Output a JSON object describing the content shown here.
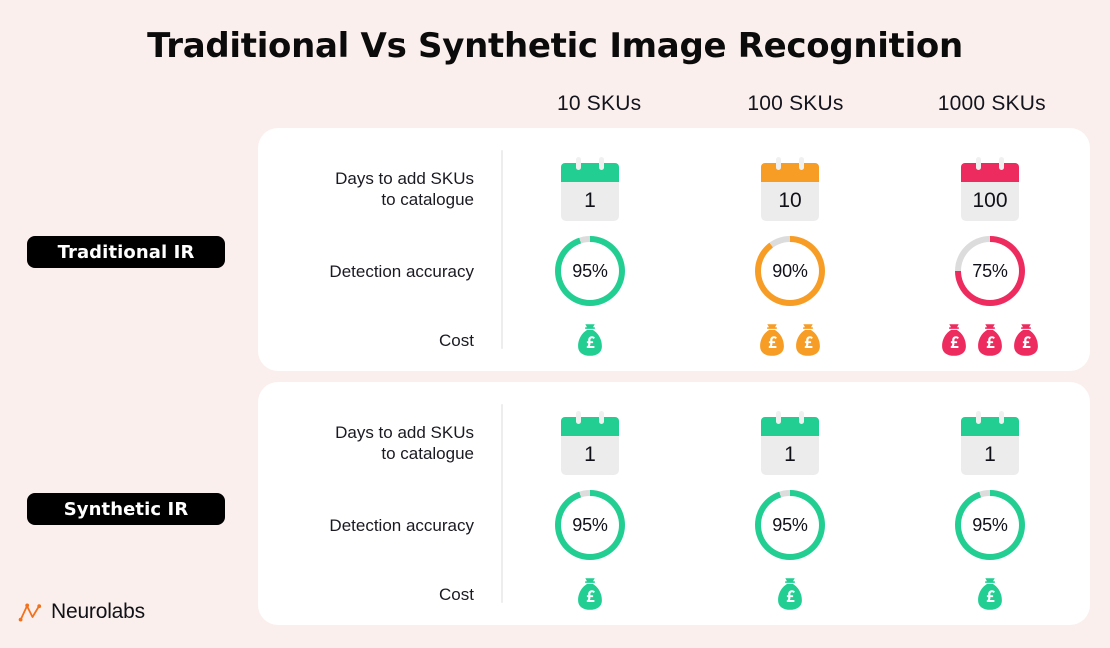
{
  "page": {
    "title": "Traditional Vs Synthetic Image Recognition",
    "background_color": "#FAEFEC",
    "card_color": "#FFFFFF"
  },
  "palette": {
    "green": "#22CE92",
    "orange": "#F79C24",
    "crimson": "#EE2B5E",
    "track_gray": "#DCDCDC",
    "calendar_body": "#ECECEC"
  },
  "columns": [
    {
      "label": "10 SKUs"
    },
    {
      "label": "100 SKUs"
    },
    {
      "label": "1000 SKUs"
    }
  ],
  "row_labels": {
    "days": "Days to add SKUs\nto catalogue",
    "days_line1": "Days to add SKUs",
    "days_line2": "to catalogue",
    "accuracy": "Detection accuracy",
    "cost": "Cost"
  },
  "sections": [
    {
      "badge": "Traditional IR",
      "days": [
        {
          "value": "1",
          "color": "#22CE92"
        },
        {
          "value": "10",
          "color": "#F79C24"
        },
        {
          "value": "100",
          "color": "#EE2B5E"
        }
      ],
      "accuracy": [
        {
          "label": "95%",
          "percent": 95,
          "color": "#22CE92"
        },
        {
          "label": "90%",
          "percent": 90,
          "color": "#F79C24"
        },
        {
          "label": "75%",
          "percent": 75,
          "color": "#EE2B5E"
        }
      ],
      "cost": [
        {
          "bags": 1,
          "color": "#22CE92"
        },
        {
          "bags": 2,
          "color": "#F79C24"
        },
        {
          "bags": 3,
          "color": "#EE2B5E"
        }
      ]
    },
    {
      "badge": "Synthetic IR",
      "days": [
        {
          "value": "1",
          "color": "#22CE92"
        },
        {
          "value": "1",
          "color": "#22CE92"
        },
        {
          "value": "1",
          "color": "#22CE92"
        }
      ],
      "accuracy": [
        {
          "label": "95%",
          "percent": 95,
          "color": "#22CE92"
        },
        {
          "label": "95%",
          "percent": 95,
          "color": "#22CE92"
        },
        {
          "label": "95%",
          "percent": 95,
          "color": "#22CE92"
        }
      ],
      "cost": [
        {
          "bags": 1,
          "color": "#22CE92"
        },
        {
          "bags": 1,
          "color": "#22CE92"
        },
        {
          "bags": 1,
          "color": "#22CE92"
        }
      ]
    }
  ],
  "logo": {
    "wordmark": "Neurolabs",
    "mark_color": "#F2711C"
  },
  "chart_data": {
    "type": "table",
    "title": "Traditional Vs Synthetic Image Recognition",
    "categories": [
      "10 SKUs",
      "100 SKUs",
      "1000 SKUs"
    ],
    "metrics": [
      "Days to add SKUs to catalogue",
      "Detection accuracy",
      "Cost"
    ],
    "groups": [
      {
        "name": "Traditional IR",
        "days_to_add_skus": [
          1,
          10,
          100
        ],
        "detection_accuracy_percent": [
          95,
          90,
          75
        ],
        "cost_bags": [
          1,
          2,
          3
        ]
      },
      {
        "name": "Synthetic IR",
        "days_to_add_skus": [
          1,
          1,
          1
        ],
        "detection_accuracy_percent": [
          95,
          95,
          95
        ],
        "cost_bags": [
          1,
          1,
          1
        ]
      }
    ]
  }
}
